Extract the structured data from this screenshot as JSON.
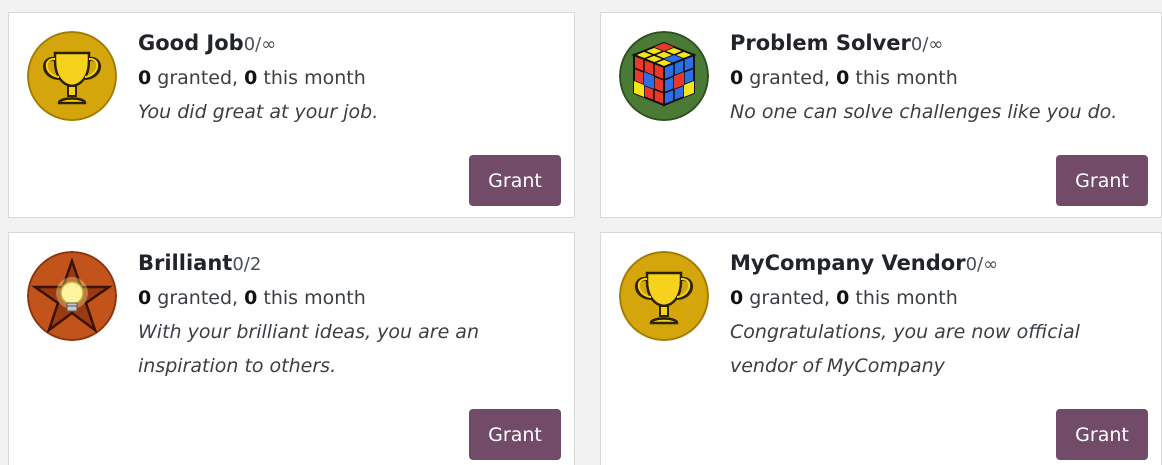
{
  "badges": [
    {
      "name": "Good Job",
      "count": "0/∞",
      "granted": "0",
      "granted_label": " granted, ",
      "month": "0",
      "month_label": " this month",
      "description": "You did great at your job.",
      "grant_label": "Grant",
      "icon": "trophy-icon"
    },
    {
      "name": "Problem Solver",
      "count": "0/∞",
      "granted": "0",
      "granted_label": " granted, ",
      "month": "0",
      "month_label": " this month",
      "description": "No one can solve challenges like you do.",
      "grant_label": "Grant",
      "icon": "rubiks-cube-icon"
    },
    {
      "name": "Brilliant",
      "count": "0/2",
      "granted": "0",
      "granted_label": " granted, ",
      "month": "0",
      "month_label": " this month",
      "description": "With your brilliant ideas, you are an inspiration to others.",
      "grant_label": "Grant",
      "icon": "star-lightbulb-icon"
    },
    {
      "name": "MyCompany Vendor",
      "count": "0/∞",
      "granted": "0",
      "granted_label": " granted, ",
      "month": "0",
      "month_label": " this month",
      "description": "Congratulations, you are now official vendor of MyCompany",
      "grant_label": "Grant",
      "icon": "trophy-icon"
    }
  ],
  "colors": {
    "grant_button": "#714b67",
    "trophy_bg": "#d4a60c",
    "brilliant_bg": "#c2531b",
    "cube_bg": "#4a7a36"
  }
}
